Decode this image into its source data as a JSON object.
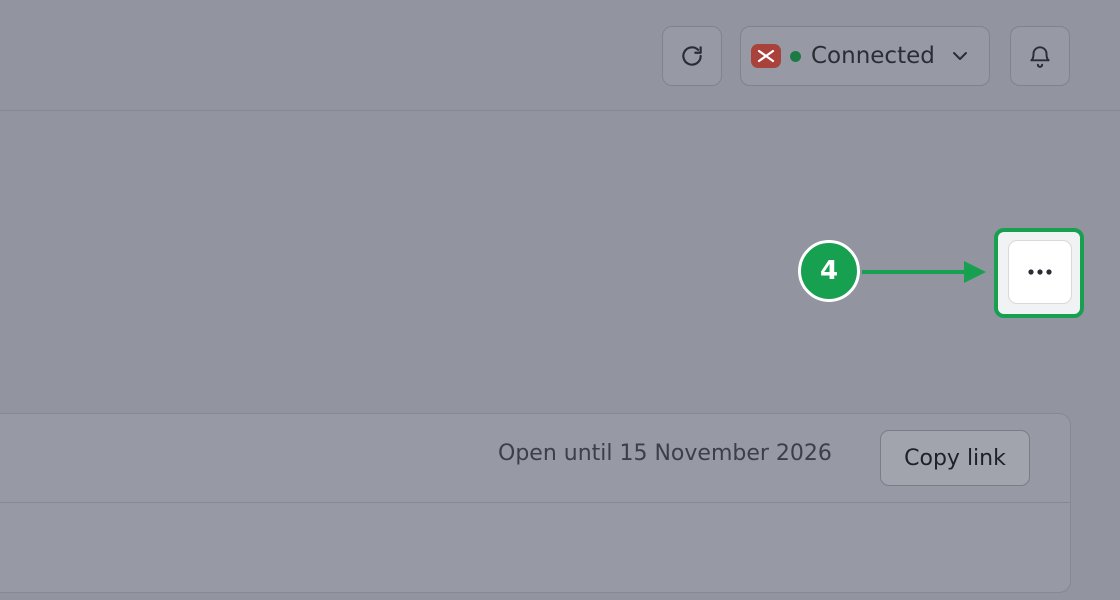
{
  "header": {
    "refresh_icon": "refresh-icon",
    "status": {
      "brand_icon": "app-brand-icon",
      "dot_color": "#1d7a45",
      "label": "Connected",
      "dropdown_icon": "chevron-down-icon"
    },
    "notifications_icon": "bell-icon"
  },
  "annotation": {
    "step_number": "4",
    "accent_color": "#17a04f"
  },
  "more_button": {
    "icon": "more-horizontal-icon"
  },
  "share_card": {
    "open_until": "Open until 15 November 2026",
    "copy_link_label": "Copy link"
  }
}
